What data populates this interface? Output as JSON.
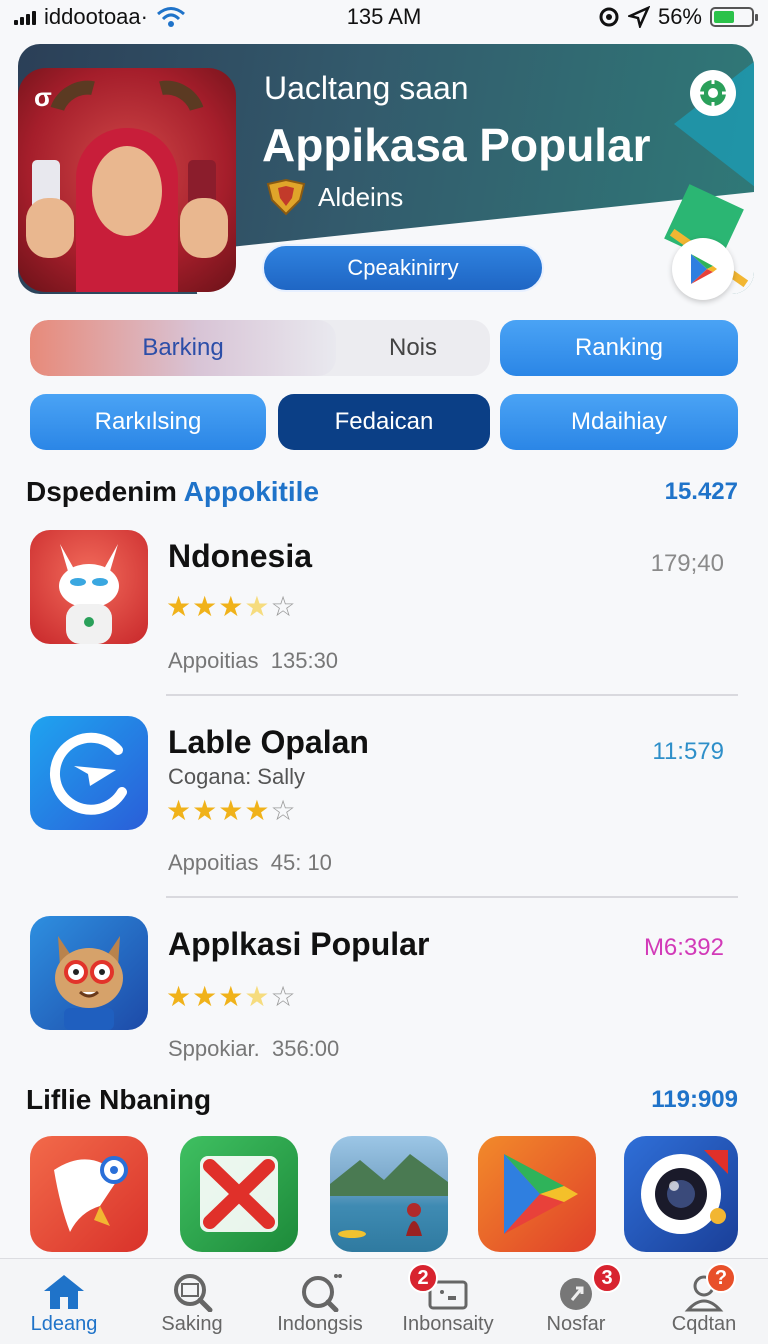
{
  "status_bar": {
    "carrier": "iddootoaa·",
    "time": "135 AM",
    "battery": "56%",
    "battery_level": 0.56
  },
  "hero": {
    "subtitle": "Uacltang saan",
    "title": "Appikasa Popular",
    "badge_text": "Aldeins",
    "button_label": "Cpeakinirry",
    "corner_glyph": "σ"
  },
  "filters": {
    "seg_left": "Barking",
    "seg_right": "Nois",
    "ranking": "Ranking",
    "row2": [
      "Rarkılsing",
      "Fedaican",
      "Mdaihiay"
    ]
  },
  "section1": {
    "title_plain": "Dspedenim ",
    "title_accent": "Appokitile",
    "count": "15.427"
  },
  "apps": [
    {
      "name": "Ndonesia",
      "developer": "",
      "rating": 3.5,
      "meta_label": "Appoitias",
      "meta_value": "135:30",
      "time": "179;40",
      "time_color": "#8a8a8a"
    },
    {
      "name": "Lable Opalan",
      "developer": "Cogana:  Sally",
      "rating": 4,
      "meta_label": "Appoitias",
      "meta_value": "45: 10",
      "time": "11:579",
      "time_color": "#2e8fc9"
    },
    {
      "name": "Applkasi Popular",
      "developer": "",
      "rating": 3.5,
      "meta_label": "Sppokiar.",
      "meta_value": "356:00",
      "time": "M6:392",
      "time_color": "#d23ab8"
    }
  ],
  "section2": {
    "title": "Liflie Nbaning",
    "count": "119:909"
  },
  "bottom_nav": [
    {
      "label": "Ldeang",
      "icon": "home-icon",
      "badge": ""
    },
    {
      "label": "Saking",
      "icon": "search-box-icon",
      "badge": ""
    },
    {
      "label": "Indongsis",
      "icon": "search-icon",
      "badge": ""
    },
    {
      "label": "Inbonsaity",
      "icon": "wallet-icon",
      "badge": "2"
    },
    {
      "label": "Nosfar",
      "icon": "rocket-icon",
      "badge": "3"
    },
    {
      "label": "Cqdtan",
      "icon": "profile-icon",
      "badge": "?"
    }
  ],
  "colors": {
    "accent": "#1f73c9",
    "nav_active": "#1f73c9",
    "badge": "#d8232f",
    "star": "#f0b21a"
  }
}
